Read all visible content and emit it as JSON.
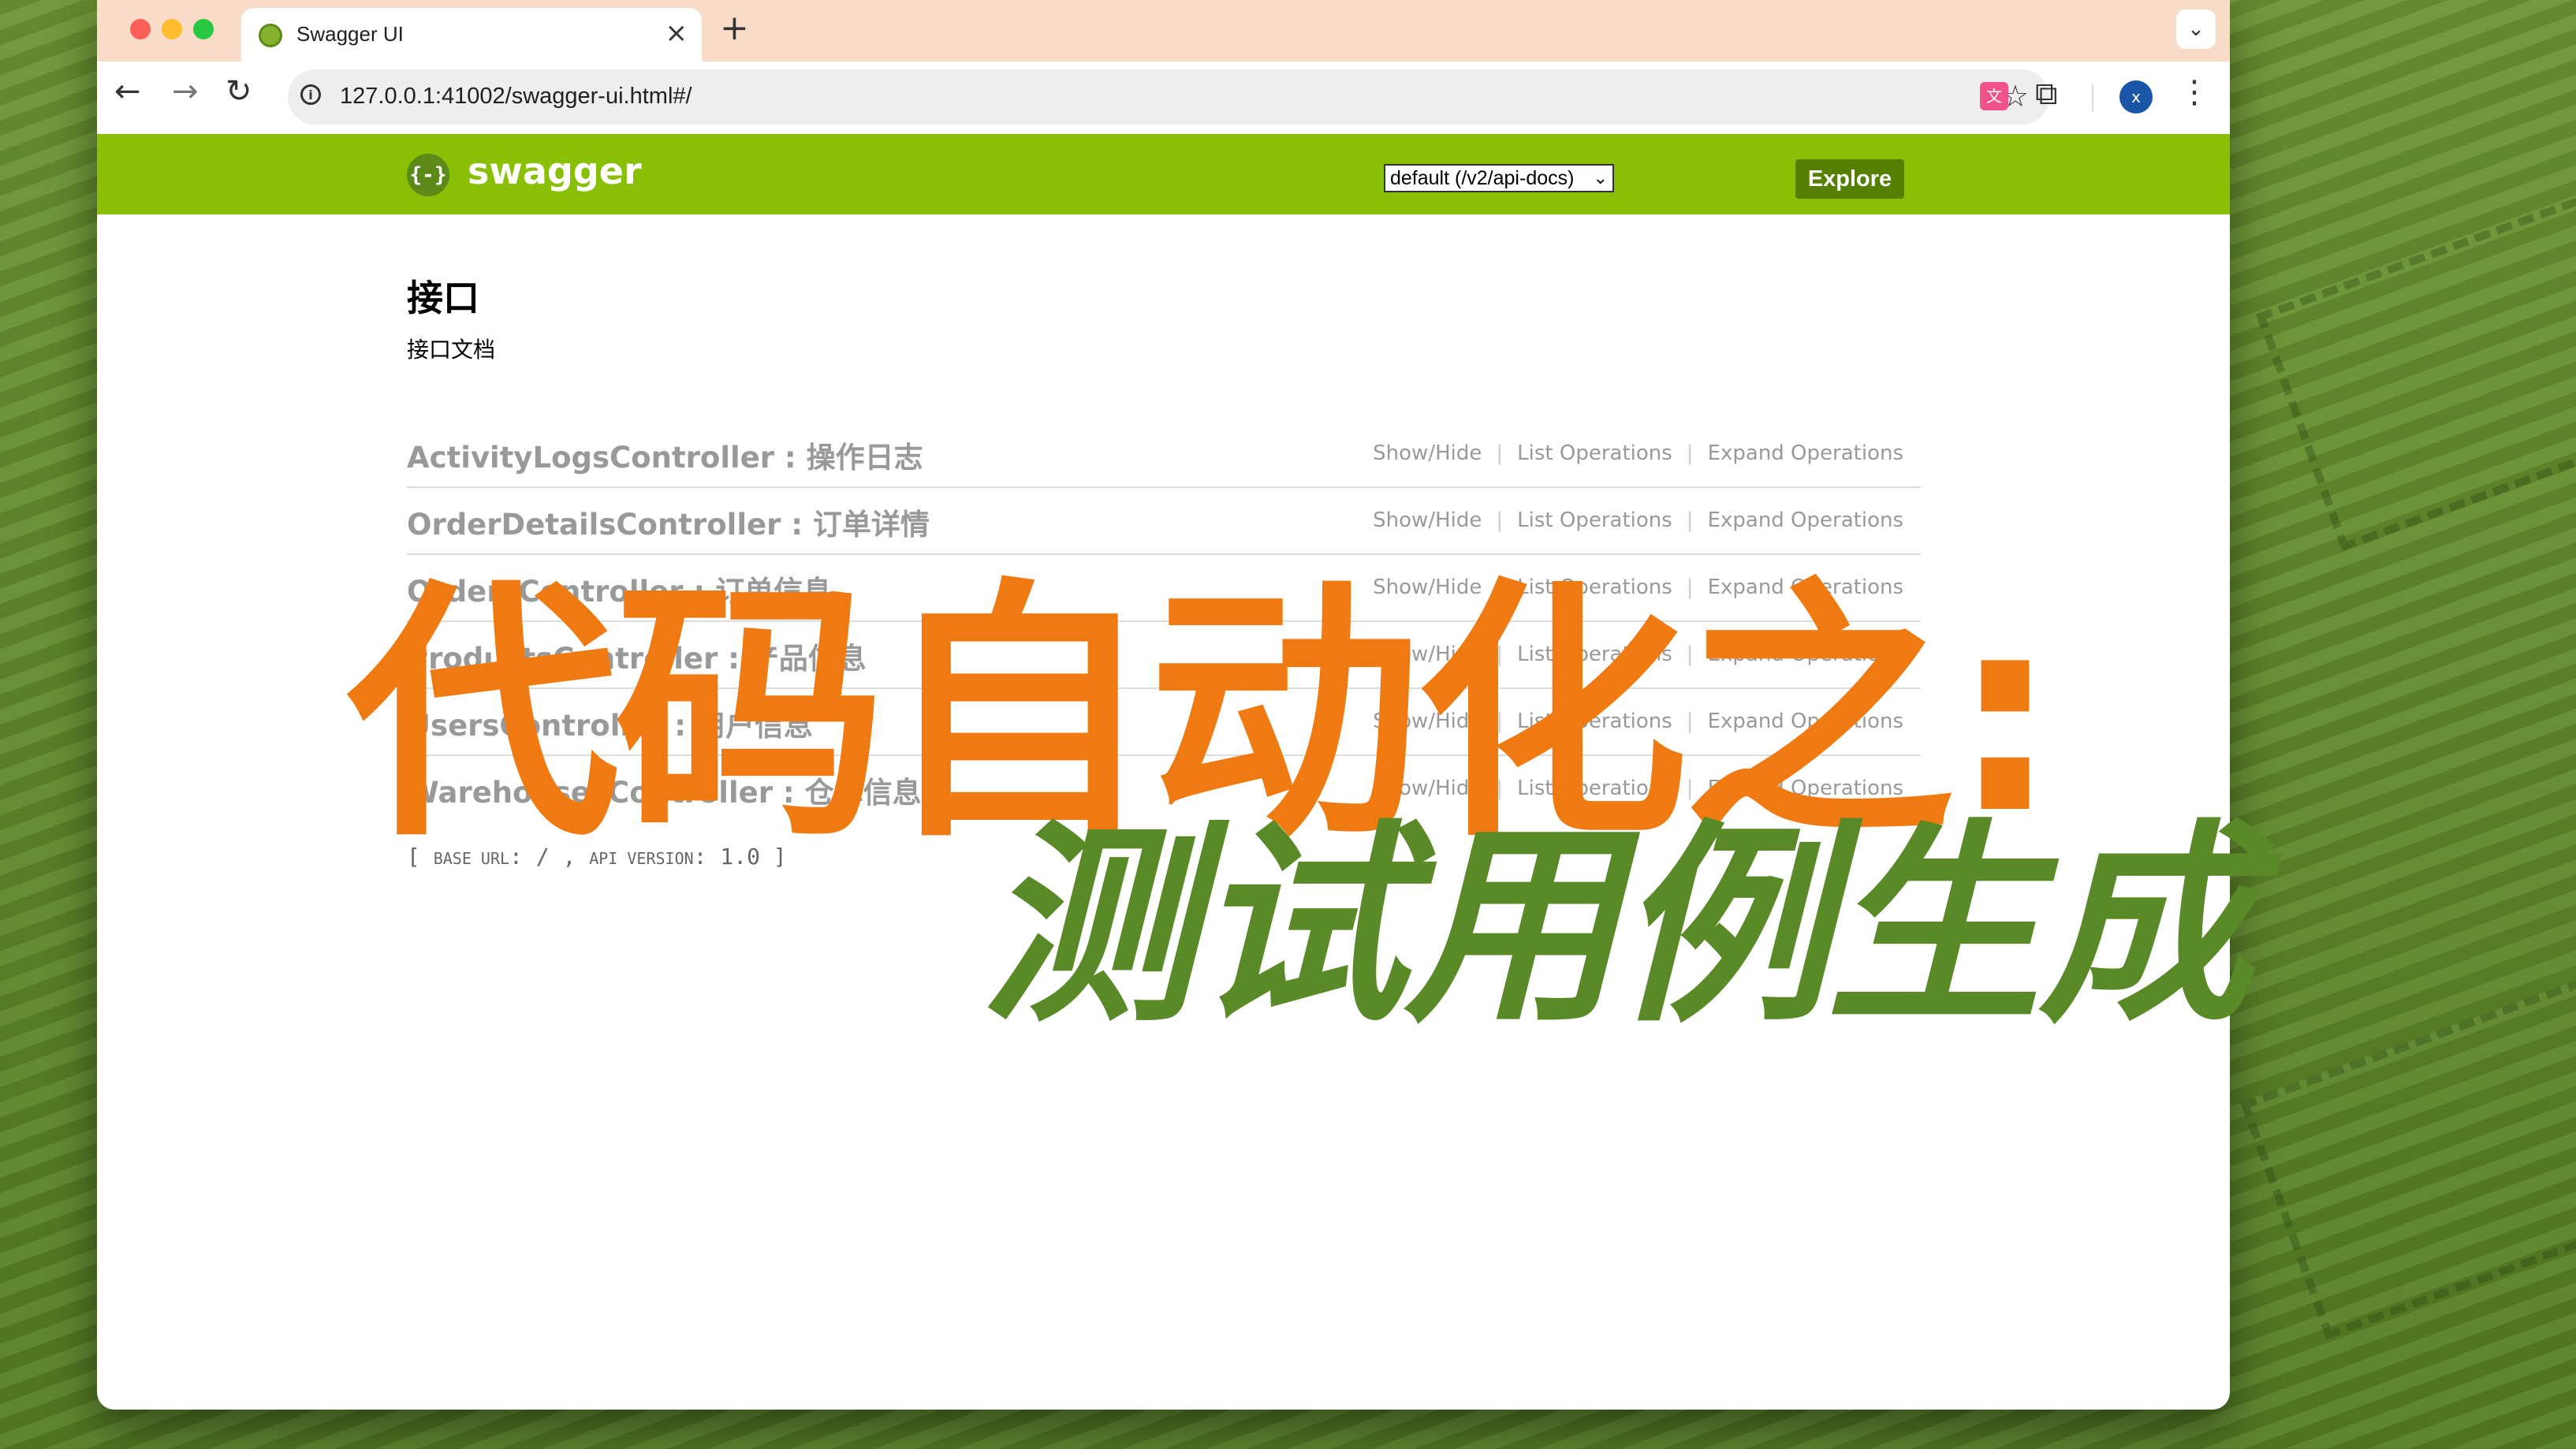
{
  "browser": {
    "tab_title": "Swagger UI",
    "tab_close": "×",
    "new_tab": "+",
    "tab_list_caret": "⌄",
    "url": "127.0.0.1:41002/swagger-ui.html#/",
    "back_icon": "←",
    "forward_icon": "→",
    "reload_icon": "↻",
    "star_icon": "☆",
    "extension_icon": "⧉",
    "profile_initial": "x",
    "menu_icon": "⋮",
    "info_icon": "i"
  },
  "swagger": {
    "logo_text": "swagger",
    "logo_glyph": "{-}",
    "api_selector": "default (/v2/api-docs)",
    "api_selector_caret": "⌄",
    "explore_label": "Explore",
    "brand_color": "#89bf04"
  },
  "info": {
    "title": "接口",
    "description": "接口文档"
  },
  "resources": [
    {
      "name": "ActivityLogsController : 操作日志",
      "show_hide": "Show/Hide",
      "list_ops": "List Operations",
      "expand_ops": "Expand Operations"
    },
    {
      "name": "OrderDetailsController : 订单详情",
      "show_hide": "Show/Hide",
      "list_ops": "List Operations",
      "expand_ops": "Expand Operations"
    },
    {
      "name": "OrdersController : 订单信息",
      "show_hide": "Show/Hide",
      "list_ops": "List Operations",
      "expand_ops": "Expand Operations"
    },
    {
      "name": "ProductsController : 产品信息",
      "show_hide": "Show/Hide",
      "list_ops": "List Operations",
      "expand_ops": "Expand Operations"
    },
    {
      "name": "UsersController : 用户信息",
      "show_hide": "Show/Hide",
      "list_ops": "List Operations",
      "expand_ops": "Expand Operations"
    },
    {
      "name": "WarehousesController : 仓库信息",
      "show_hide": "Show/Hide",
      "list_ops": "List Operations",
      "expand_ops": "Expand Operations"
    }
  ],
  "footer": {
    "base_url_label": "BASE URL",
    "base_url_value": ": / , ",
    "api_version_label": "API VERSION",
    "api_version_value": ": 1.0 ]",
    "bracket_open": "["
  },
  "overlay": {
    "line1": "代码自动化之:",
    "line2": "测试用例生成",
    "line1_color": "#f07a12",
    "line2_color": "#5a8a27"
  }
}
